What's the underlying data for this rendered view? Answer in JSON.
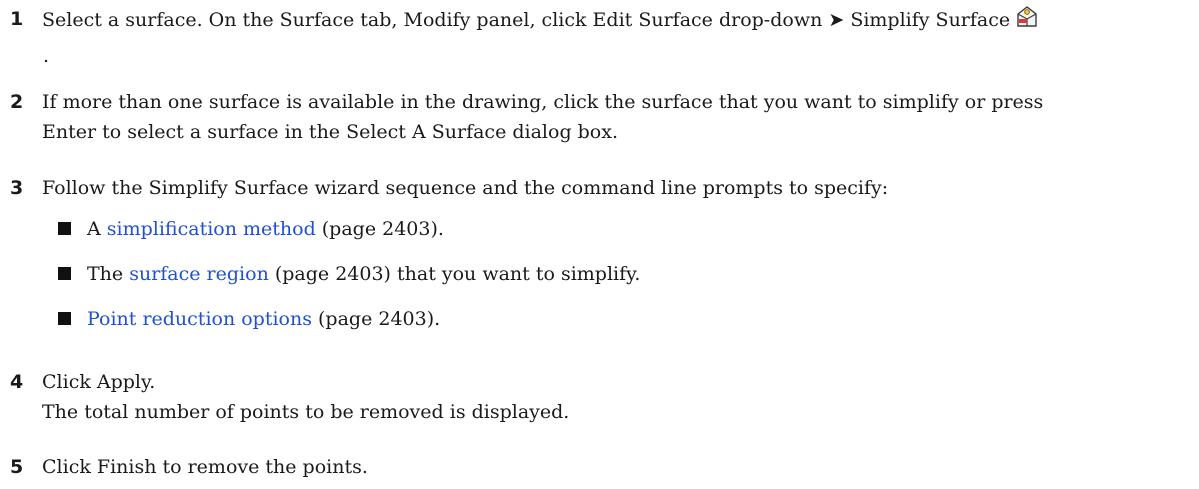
{
  "steps": [
    {
      "number": "1",
      "text": "Select a surface. On the Surface tab, Modify panel, click Edit Surface drop-down ➤ Simplify Surface",
      "trailing": "."
    },
    {
      "number": "2",
      "line1": "If more than one surface is available in the drawing, click the surface that you want to simplify or press",
      "line2": "Enter to select a surface in the Select A Surface dialog box."
    },
    {
      "number": "3",
      "text": "Follow the Simplify Surface wizard sequence and the command line prompts to specify:",
      "bullets": [
        {
          "prefix": "A ",
          "link": "simplification method",
          "suffix": " (page 2403)."
        },
        {
          "prefix": "The ",
          "link": "surface region",
          "suffix": " (page 2403) that you want to simplify."
        },
        {
          "prefix": "",
          "link": "Point reduction options",
          "suffix": " (page 2403)."
        }
      ]
    },
    {
      "number": "4",
      "text": "Click Apply.",
      "note": "The total number of points to be removed is displayed."
    },
    {
      "number": "5",
      "text": "Click Finish to remove the points."
    }
  ],
  "icons": {
    "simplify_surface": "simplify-surface-icon"
  },
  "colors": {
    "link": "#1f4fd6",
    "text": "#1a1a1a"
  }
}
